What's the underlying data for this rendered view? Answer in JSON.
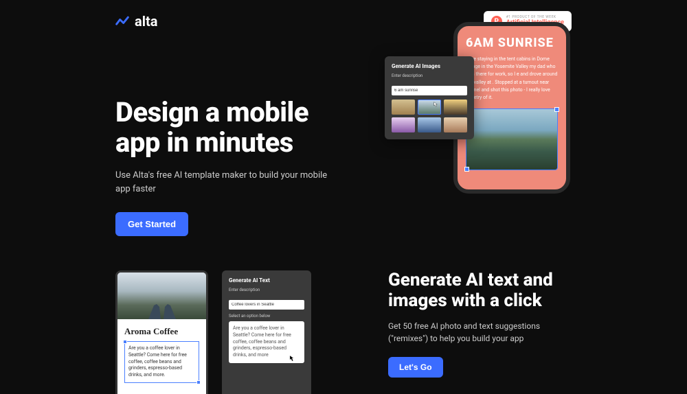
{
  "header": {
    "logo_text": "alta",
    "badge": {
      "top_text": "#1 PRODUCT OF THE WEEK",
      "bottom_text": "Artificial Intelligence",
      "p_letter": "P"
    }
  },
  "hero": {
    "title": "Design a mobile app in minutes",
    "subtitle": "Use Alta's free AI template maker to build your mobile app faster",
    "cta": "Get Started",
    "phone": {
      "title": "6AM SUNRISE",
      "text": "were staying in the tent cabins in Dome Village in the Yosemite Valley my dad who was there for work, so I e and drove around the valley at . Stopped at a turnout near Tunnel and shot this photo - I really love the etry of it."
    },
    "ai_panel": {
      "title": "Generate AI Images",
      "label": "Enter description",
      "input_value": "6 am sunrise"
    }
  },
  "section2": {
    "title": "Generate AI text and images with a click",
    "subtitle": "Get 50 free AI photo and text suggestions (\"remixes\") to help you build your app",
    "cta": "Let's Go",
    "phone": {
      "title": "Aroma Coffee",
      "text": "Are you a coffee lover in Seattle? Come here for free coffee, coffee beans and grinders, espresso-based drinks, and more."
    },
    "ai_text_panel": {
      "title": "Generate AI Text",
      "label": "Enter description",
      "input_value": "Coffee lovers in Seattle",
      "select_label": "Select an option below",
      "option_text": "Are you a coffee lover in Seattle? Come here for free coffee, coffee beans and grinders, espresso-based drinks, and more"
    }
  }
}
